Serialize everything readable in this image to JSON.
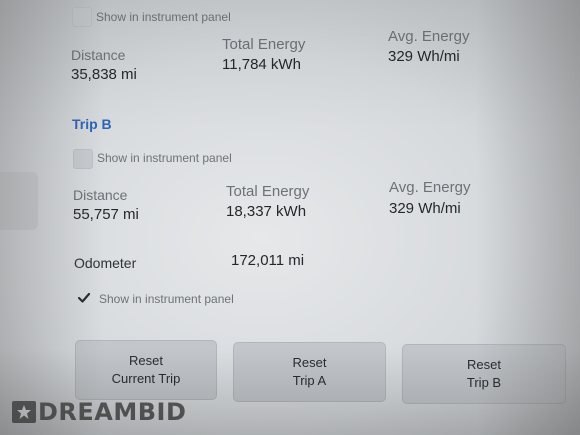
{
  "trip_a": {
    "show_instrument_panel_label": "Show in instrument panel",
    "distance_label": "Distance",
    "distance_value": "35,838 mi",
    "total_energy_label": "Total Energy",
    "total_energy_value": "11,784 kWh",
    "avg_energy_label": "Avg. Energy",
    "avg_energy_value": "329 Wh/mi"
  },
  "trip_b": {
    "title": "Trip B",
    "show_instrument_panel_label": "Show in instrument panel",
    "distance_label": "Distance",
    "distance_value": "55,757 mi",
    "total_energy_label": "Total Energy",
    "total_energy_value": "18,337 kWh",
    "avg_energy_label": "Avg. Energy",
    "avg_energy_value": "329 Wh/mi"
  },
  "odometer": {
    "label": "Odometer",
    "value": "172,011 mi",
    "show_instrument_panel_label": "Show in instrument panel",
    "show_instrument_panel_checked": true
  },
  "buttons": {
    "reset_current_trip_line1": "Reset",
    "reset_current_trip_line2": "Current Trip",
    "reset_trip_a_line1": "Reset",
    "reset_trip_a_line2": "Trip A",
    "reset_trip_b_line1": "Reset",
    "reset_trip_b_line2": "Trip B"
  },
  "watermark": {
    "text": "DREAMBID"
  },
  "colors": {
    "accent": "#2e64b8",
    "background": "#dcdfe2",
    "button": "#c3c6ca"
  }
}
